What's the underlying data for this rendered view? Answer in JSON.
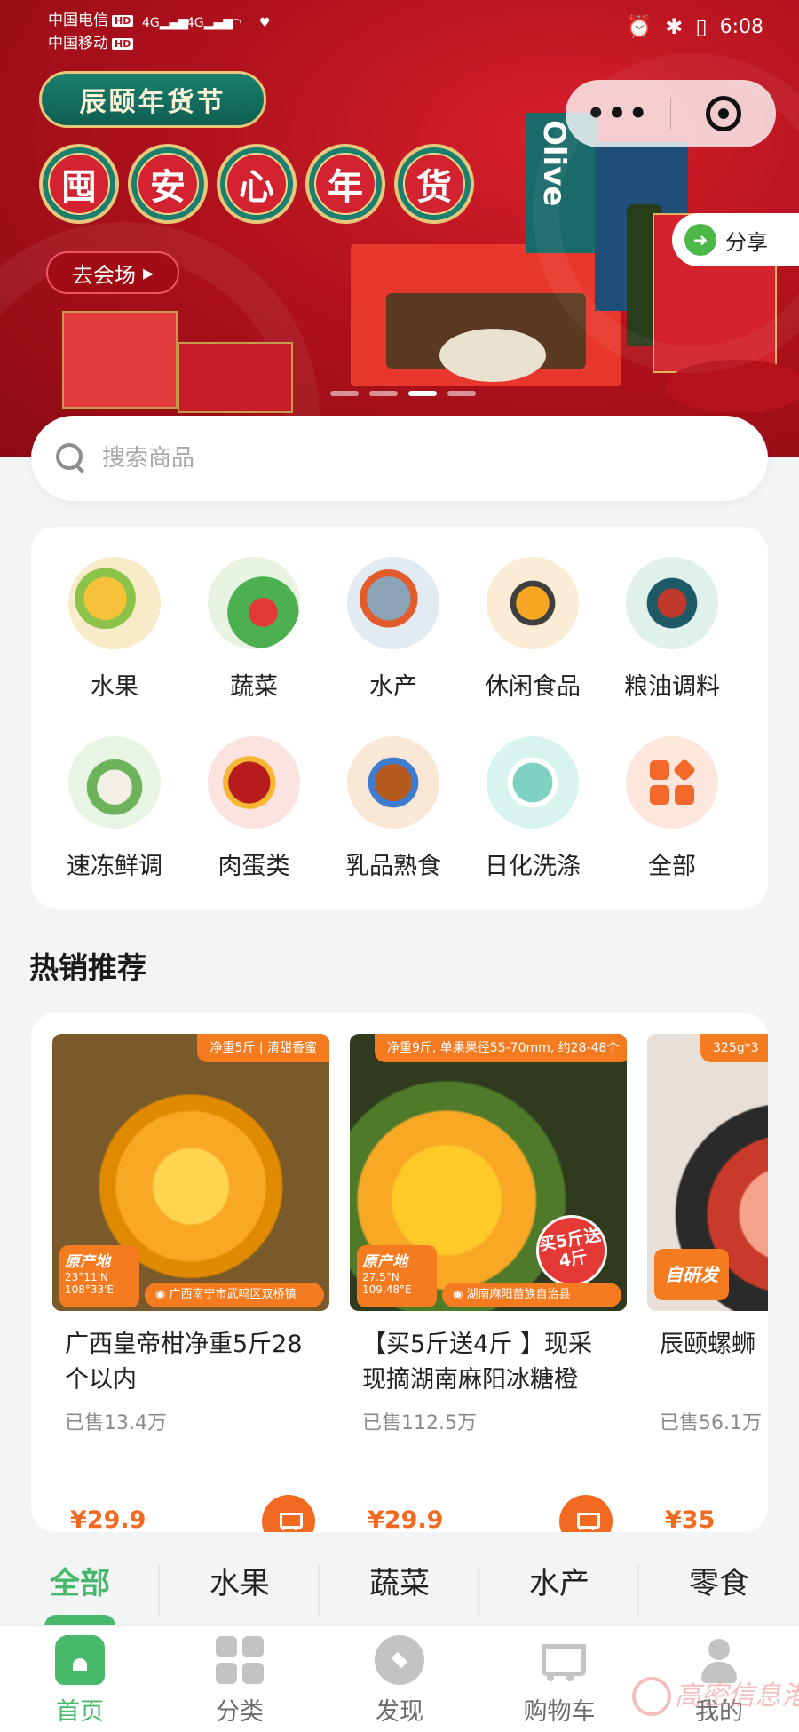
{
  "status_bar": {
    "carrier_1": "中国电信",
    "carrier_2": "中国移动",
    "hd_label": "HD",
    "network": "4G",
    "time": "6:08",
    "icons": [
      "alarm-icon",
      "bluetooth-icon",
      "vibrate-icon",
      "battery-icon"
    ]
  },
  "banner": {
    "festival_tag": "辰颐年货节",
    "seal_chars": [
      "囤",
      "安",
      "心",
      "年",
      "货"
    ],
    "cta": "去会场",
    "cta_arrow": "▸",
    "product_label": "Olive",
    "page_count": 4,
    "active_page": 3
  },
  "capsule": {
    "more": "•••",
    "close_icon": "target-close-icon"
  },
  "share": {
    "label": "分享"
  },
  "search": {
    "placeholder": "搜索商品"
  },
  "categories": [
    {
      "label": "水果",
      "icon": "fruit-icon"
    },
    {
      "label": "蔬菜",
      "icon": "vegetable-icon"
    },
    {
      "label": "水产",
      "icon": "seafood-icon"
    },
    {
      "label": "休闲食品",
      "icon": "snack-icon"
    },
    {
      "label": "粮油调料",
      "icon": "grain-oil-icon"
    },
    {
      "label": "速冻鲜调",
      "icon": "frozen-food-icon"
    },
    {
      "label": "肉蛋类",
      "icon": "meat-egg-icon"
    },
    {
      "label": "乳品熟食",
      "icon": "dairy-deli-icon"
    },
    {
      "label": "日化洗涤",
      "icon": "household-icon"
    },
    {
      "label": "全部",
      "icon": "all-grid-icon"
    }
  ],
  "hot": {
    "title": "热销推荐",
    "products": [
      {
        "ribbon": "净重5斤 | 清甜香蜜",
        "origin_title": "原产地",
        "coords": "23°11'N 108°33'E",
        "location": "广西南宁市武鸣区双桥镇",
        "name": "广西皇帝柑净重5斤28个以内",
        "sold": "已售13.4万",
        "price": "¥29.9"
      },
      {
        "ribbon": "净重9斤, 单果果径55-70mm, 约28-48个",
        "origin_title": "原产地",
        "coords": "27.5°N 109.48°E",
        "location": "湖南麻阳苗族自治县",
        "promo": "买5斤送4斤",
        "name": "【买5斤送4斤 】现采现摘湖南麻阳冰糖橙",
        "sold": "已售112.5万",
        "price": "¥29.9"
      },
      {
        "ribbon": "325g*3",
        "self_badge": "自研发",
        "name": "辰颐螺蛳",
        "sold": "已售56.1万",
        "price": "¥35"
      }
    ]
  },
  "subtabs": [
    "全部",
    "水果",
    "蔬菜",
    "水产",
    "零食"
  ],
  "bottom_nav": [
    {
      "label": "首页",
      "icon": "home-icon",
      "active": true
    },
    {
      "label": "分类",
      "icon": "category-grid-icon",
      "active": false
    },
    {
      "label": "发现",
      "icon": "compass-icon",
      "active": false
    },
    {
      "label": "购物车",
      "icon": "cart-icon",
      "active": false
    },
    {
      "label": "我的",
      "icon": "user-icon",
      "active": false
    }
  ],
  "colors": {
    "brand_green": "#48b86a",
    "accent_orange": "#f26a22",
    "banner_red": "#b1121d"
  }
}
